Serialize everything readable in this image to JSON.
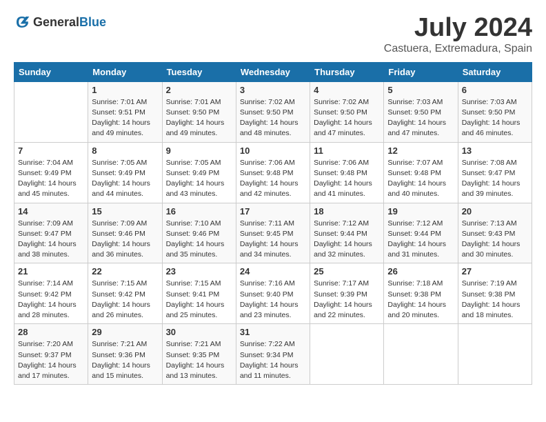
{
  "header": {
    "logo_general": "General",
    "logo_blue": "Blue",
    "month": "July 2024",
    "location": "Castuera, Extremadura, Spain"
  },
  "days_of_week": [
    "Sunday",
    "Monday",
    "Tuesday",
    "Wednesday",
    "Thursday",
    "Friday",
    "Saturday"
  ],
  "weeks": [
    [
      {
        "day": "",
        "info": ""
      },
      {
        "day": "1",
        "info": "Sunrise: 7:01 AM\nSunset: 9:51 PM\nDaylight: 14 hours\nand 49 minutes."
      },
      {
        "day": "2",
        "info": "Sunrise: 7:01 AM\nSunset: 9:50 PM\nDaylight: 14 hours\nand 49 minutes."
      },
      {
        "day": "3",
        "info": "Sunrise: 7:02 AM\nSunset: 9:50 PM\nDaylight: 14 hours\nand 48 minutes."
      },
      {
        "day": "4",
        "info": "Sunrise: 7:02 AM\nSunset: 9:50 PM\nDaylight: 14 hours\nand 47 minutes."
      },
      {
        "day": "5",
        "info": "Sunrise: 7:03 AM\nSunset: 9:50 PM\nDaylight: 14 hours\nand 47 minutes."
      },
      {
        "day": "6",
        "info": "Sunrise: 7:03 AM\nSunset: 9:50 PM\nDaylight: 14 hours\nand 46 minutes."
      }
    ],
    [
      {
        "day": "7",
        "info": "Sunrise: 7:04 AM\nSunset: 9:49 PM\nDaylight: 14 hours\nand 45 minutes."
      },
      {
        "day": "8",
        "info": "Sunrise: 7:05 AM\nSunset: 9:49 PM\nDaylight: 14 hours\nand 44 minutes."
      },
      {
        "day": "9",
        "info": "Sunrise: 7:05 AM\nSunset: 9:49 PM\nDaylight: 14 hours\nand 43 minutes."
      },
      {
        "day": "10",
        "info": "Sunrise: 7:06 AM\nSunset: 9:48 PM\nDaylight: 14 hours\nand 42 minutes."
      },
      {
        "day": "11",
        "info": "Sunrise: 7:06 AM\nSunset: 9:48 PM\nDaylight: 14 hours\nand 41 minutes."
      },
      {
        "day": "12",
        "info": "Sunrise: 7:07 AM\nSunset: 9:48 PM\nDaylight: 14 hours\nand 40 minutes."
      },
      {
        "day": "13",
        "info": "Sunrise: 7:08 AM\nSunset: 9:47 PM\nDaylight: 14 hours\nand 39 minutes."
      }
    ],
    [
      {
        "day": "14",
        "info": "Sunrise: 7:09 AM\nSunset: 9:47 PM\nDaylight: 14 hours\nand 38 minutes."
      },
      {
        "day": "15",
        "info": "Sunrise: 7:09 AM\nSunset: 9:46 PM\nDaylight: 14 hours\nand 36 minutes."
      },
      {
        "day": "16",
        "info": "Sunrise: 7:10 AM\nSunset: 9:46 PM\nDaylight: 14 hours\nand 35 minutes."
      },
      {
        "day": "17",
        "info": "Sunrise: 7:11 AM\nSunset: 9:45 PM\nDaylight: 14 hours\nand 34 minutes."
      },
      {
        "day": "18",
        "info": "Sunrise: 7:12 AM\nSunset: 9:44 PM\nDaylight: 14 hours\nand 32 minutes."
      },
      {
        "day": "19",
        "info": "Sunrise: 7:12 AM\nSunset: 9:44 PM\nDaylight: 14 hours\nand 31 minutes."
      },
      {
        "day": "20",
        "info": "Sunrise: 7:13 AM\nSunset: 9:43 PM\nDaylight: 14 hours\nand 30 minutes."
      }
    ],
    [
      {
        "day": "21",
        "info": "Sunrise: 7:14 AM\nSunset: 9:42 PM\nDaylight: 14 hours\nand 28 minutes."
      },
      {
        "day": "22",
        "info": "Sunrise: 7:15 AM\nSunset: 9:42 PM\nDaylight: 14 hours\nand 26 minutes."
      },
      {
        "day": "23",
        "info": "Sunrise: 7:15 AM\nSunset: 9:41 PM\nDaylight: 14 hours\nand 25 minutes."
      },
      {
        "day": "24",
        "info": "Sunrise: 7:16 AM\nSunset: 9:40 PM\nDaylight: 14 hours\nand 23 minutes."
      },
      {
        "day": "25",
        "info": "Sunrise: 7:17 AM\nSunset: 9:39 PM\nDaylight: 14 hours\nand 22 minutes."
      },
      {
        "day": "26",
        "info": "Sunrise: 7:18 AM\nSunset: 9:38 PM\nDaylight: 14 hours\nand 20 minutes."
      },
      {
        "day": "27",
        "info": "Sunrise: 7:19 AM\nSunset: 9:38 PM\nDaylight: 14 hours\nand 18 minutes."
      }
    ],
    [
      {
        "day": "28",
        "info": "Sunrise: 7:20 AM\nSunset: 9:37 PM\nDaylight: 14 hours\nand 17 minutes."
      },
      {
        "day": "29",
        "info": "Sunrise: 7:21 AM\nSunset: 9:36 PM\nDaylight: 14 hours\nand 15 minutes."
      },
      {
        "day": "30",
        "info": "Sunrise: 7:21 AM\nSunset: 9:35 PM\nDaylight: 14 hours\nand 13 minutes."
      },
      {
        "day": "31",
        "info": "Sunrise: 7:22 AM\nSunset: 9:34 PM\nDaylight: 14 hours\nand 11 minutes."
      },
      {
        "day": "",
        "info": ""
      },
      {
        "day": "",
        "info": ""
      },
      {
        "day": "",
        "info": ""
      }
    ]
  ]
}
